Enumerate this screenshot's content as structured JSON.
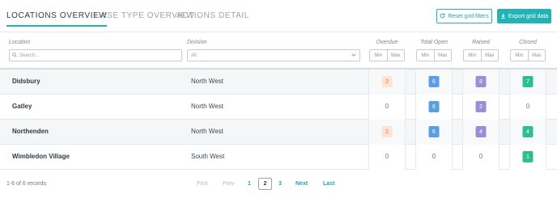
{
  "tabs": [
    {
      "label": "LOCATIONS OVERVIEW",
      "active": true
    },
    {
      "label": "CASE TYPE OVERVIEW",
      "active": false
    },
    {
      "label": "ACTIONS DETAIL",
      "active": false
    }
  ],
  "toolbar": {
    "reset_label": "Reset grid filters",
    "export_label": "Export grid data"
  },
  "columns": {
    "location": "Location",
    "division": "Division",
    "overdue": "Overdue",
    "total_open": "Total Open",
    "raised": "Raised",
    "closed": "Closed"
  },
  "filters": {
    "search_placeholder": "Search...",
    "division_value": "All",
    "min_label": "Min",
    "max_label": "Max"
  },
  "colors": {
    "accent": "#23b3b5",
    "overdue_bg": "#fde3d4",
    "overdue_fg": "#e57f4e",
    "open_bg": "#5b9fe0",
    "raised_bg": "#9b8ed6",
    "closed_bg": "#2fbf8f"
  },
  "rows": [
    {
      "location": "Didsbury",
      "division": "North West",
      "overdue": "3",
      "total_open": "6",
      "raised": "8",
      "closed": "7"
    },
    {
      "location": "Gatley",
      "division": "North West",
      "overdue": "0",
      "total_open": "6",
      "raised": "2",
      "closed": "0"
    },
    {
      "location": "Northenden",
      "division": "North West",
      "overdue": "2",
      "total_open": "6",
      "raised": "4",
      "closed": "4"
    },
    {
      "location": "Wimbledon Village",
      "division": "South West",
      "overdue": "0",
      "total_open": "0",
      "raised": "0",
      "closed": "1"
    }
  ],
  "footer": {
    "records": "1-6 of 6 records",
    "first": "First",
    "prev": "Prev",
    "pages": [
      "1",
      "2",
      "3"
    ],
    "current_page": "2",
    "next": "Next",
    "last": "Last"
  }
}
